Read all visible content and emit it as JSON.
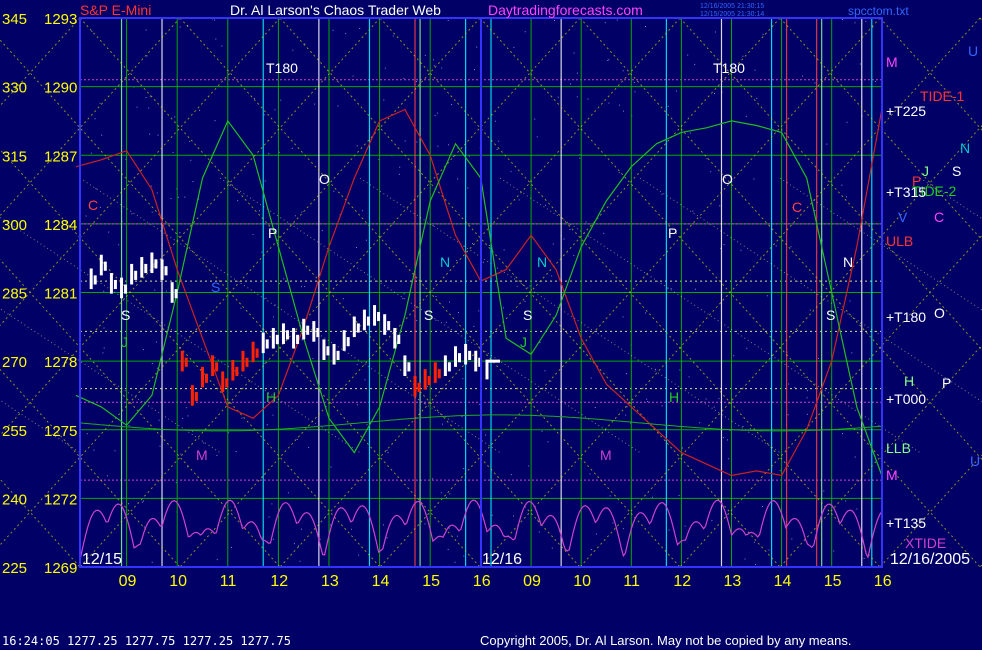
{
  "header": {
    "symbol": "S&P E-Mini",
    "title": "Dr. Al Larson's Chaos Trader Web",
    "site": "Daytradingforecasts.com",
    "file": "spcctom.txt",
    "timestamp_top": "12/16/2005 21:30:15",
    "timestamp_bottom": "12/15/2005 21:30:14"
  },
  "footer": {
    "quote": "16:24:05  1277.25  1277.75  1277.25  1277.75",
    "copyright": "Copyright 2005, Dr. Al Larson. May not be copied by any means."
  },
  "colors": {
    "background": "#000066",
    "grid_green": "#00aa00",
    "grid_yellow": "#cccc00",
    "price_bars": "#ffffff",
    "price_red": "#ff2200",
    "tide1": "#cc2222",
    "tide2": "#22bb22",
    "xtide": "#cc44cc",
    "frame": "#3333ff"
  },
  "chart_data": {
    "type": "line",
    "title": "S&P E-Mini",
    "xlabel": "",
    "ylabel": "",
    "ylim": [
      1269,
      1293
    ],
    "y_ticks_left": [
      "345",
      "330",
      "315",
      "300",
      "285",
      "270",
      "255",
      "240",
      "225"
    ],
    "y_ticks_price": [
      "1293",
      "1290",
      "1287",
      "1284",
      "1281",
      "1278",
      "1275",
      "1272",
      "1269"
    ],
    "x_ticks": [
      "09",
      "10",
      "11",
      "12",
      "13",
      "14",
      "15",
      "16",
      "09",
      "10",
      "11",
      "12",
      "13",
      "14",
      "15",
      "16"
    ],
    "date_labels": [
      "12/15",
      "12/16",
      "12/16/2005"
    ],
    "right_labels": [
      "M",
      "TIDE-1",
      "+T225",
      "N",
      "S",
      "J",
      "P",
      "TIDE-2",
      "+T315",
      "V",
      "C",
      "ULB",
      "+T180",
      "O",
      "H",
      "P",
      "+T000",
      "LLB",
      "U",
      "M",
      "+T135",
      "XTIDE"
    ],
    "top_right_letter": "U",
    "overlay_labels": [
      "T180",
      "T180",
      "C",
      "O",
      "O",
      "P",
      "P",
      "N",
      "N",
      "N",
      "S",
      "S",
      "S",
      "S",
      "S",
      "H",
      "H",
      "M",
      "M",
      "J",
      "J",
      "C"
    ],
    "series": [
      {
        "name": "S&P E-Mini",
        "x": [
          8.3,
          8.5,
          8.7,
          8.9,
          9.1,
          9.3,
          9.5,
          9.7,
          9.9,
          10.1,
          10.3,
          10.5,
          10.7,
          10.9,
          11.1,
          11.3,
          11.5,
          11.7,
          11.9,
          12.1,
          12.3,
          12.5,
          12.7,
          12.9,
          13.1,
          13.3,
          13.5,
          13.7,
          13.9,
          14.1,
          14.3,
          14.5,
          14.7,
          14.9,
          15.1,
          15.3,
          15.5,
          15.7,
          15.9
        ],
        "values": [
          1281.6,
          1282.2,
          1281.4,
          1281.2,
          1281.8,
          1282.1,
          1282.3,
          1282.0,
          1281.0,
          1278.0,
          1276.5,
          1277.3,
          1277.8,
          1277.1,
          1277.6,
          1278.0,
          1278.4,
          1278.8,
          1279.0,
          1279.2,
          1279.0,
          1279.4,
          1279.3,
          1278.5,
          1278.3,
          1278.9,
          1279.5,
          1279.8,
          1280.0,
          1279.6,
          1279.0,
          1277.8,
          1276.9,
          1277.2,
          1277.5,
          1277.8,
          1278.2,
          1278.3,
          1278.0
        ]
      },
      {
        "name": "TIDE-1",
        "x": [
          8.0,
          8.5,
          9.0,
          9.5,
          10.0,
          10.5,
          11.0,
          11.5,
          12.0,
          12.5,
          13.0,
          13.5,
          14.0,
          14.5,
          15.0,
          15.5,
          16.0,
          16.5,
          17.0,
          17.5,
          18.0,
          18.5,
          19.0,
          19.5,
          20.0,
          20.5,
          21.0,
          21.5,
          22.0,
          22.5,
          23.0,
          23.5,
          24.0
        ],
        "values": [
          1286.5,
          1286.8,
          1287.2,
          1285.5,
          1282.0,
          1279.0,
          1276.0,
          1275.5,
          1276.5,
          1279.5,
          1283.0,
          1286.0,
          1288.5,
          1289.0,
          1287.0,
          1283.5,
          1281.5,
          1282.0,
          1283.5,
          1282.0,
          1279.0,
          1277.0,
          1276.0,
          1275.0,
          1274.0,
          1273.5,
          1273.0,
          1273.2,
          1273.0,
          1275.0,
          1278.0,
          1283.0,
          1289.0
        ]
      },
      {
        "name": "TIDE-2",
        "x": [
          8.0,
          8.5,
          9.0,
          9.5,
          10.0,
          10.5,
          11.0,
          11.5,
          12.0,
          12.5,
          13.0,
          13.5,
          14.0,
          14.5,
          15.0,
          15.5,
          16.0,
          16.5,
          17.0,
          17.5,
          18.0,
          18.5,
          19.0,
          19.5,
          20.0,
          20.5,
          21.0,
          21.5,
          22.0,
          22.5,
          23.0,
          23.5,
          24.0
        ],
        "values": [
          1276.5,
          1276.0,
          1275.2,
          1276.5,
          1281.0,
          1286.0,
          1288.5,
          1287.0,
          1283.0,
          1279.0,
          1275.5,
          1274.0,
          1276.0,
          1280.0,
          1285.0,
          1287.5,
          1286.0,
          1279.0,
          1278.3,
          1280.0,
          1283.0,
          1285.0,
          1286.5,
          1287.5,
          1288.0,
          1288.2,
          1288.5,
          1288.3,
          1288.0,
          1286.0,
          1281.0,
          1276.0,
          1273.0
        ]
      }
    ]
  }
}
